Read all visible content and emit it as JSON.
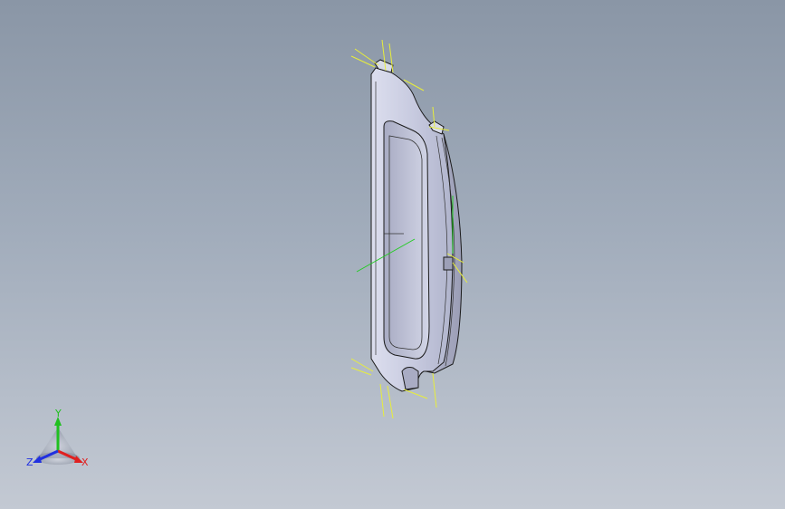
{
  "view": {
    "background_top": "#8a96a6",
    "background_bottom": "#c3c9d3",
    "model_face_color": "#c7cade",
    "model_edge_color": "#1a1a1a",
    "sketch_color": "#e8ee3a",
    "axis_line_color": "#22cc22"
  },
  "triad": {
    "x_label": "X",
    "y_label": "Y",
    "z_label": "Z",
    "x_color": "#e02020",
    "y_color": "#20c020",
    "z_color": "#2030e0"
  }
}
